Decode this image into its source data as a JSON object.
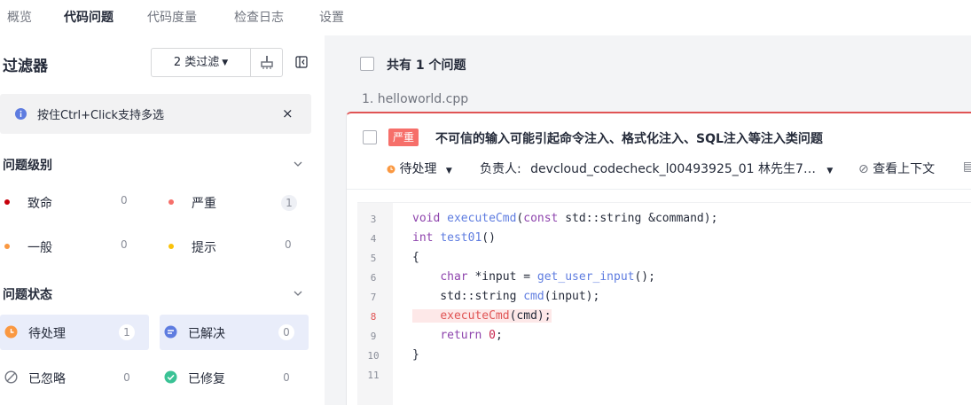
{
  "tabs": [
    "概览",
    "代码问题",
    "代码度量",
    "检查日志",
    "设置"
  ],
  "filter": {
    "title": "过滤器",
    "button_label": "2 类过滤",
    "clean_icon": "broom-icon",
    "collapse_icon": "panel-collapse-icon"
  },
  "tip": {
    "text": "按住Ctrl+Click支持多选",
    "close": "×"
  },
  "levels": {
    "title": "问题级别",
    "items": [
      {
        "name": "致命",
        "count": "0",
        "color": "#c7000b"
      },
      {
        "name": "严重",
        "count": "1",
        "color": "#f66f6a"
      },
      {
        "name": "一般",
        "count": "0",
        "color": "#fa9841"
      },
      {
        "name": "提示",
        "count": "0",
        "color": "#fac20a"
      }
    ]
  },
  "status": {
    "title": "问题状态",
    "items": [
      {
        "name": "待处理",
        "count": "1",
        "icon": "pending-icon",
        "color": "#fa9841",
        "selected": true
      },
      {
        "name": "已解决",
        "count": "0",
        "icon": "resolved-icon",
        "color": "#5e7ce0",
        "selected": true
      },
      {
        "name": "已忽略",
        "count": "0",
        "icon": "ignored-icon",
        "color": "#71757f",
        "selected": false
      },
      {
        "name": "已修复",
        "count": "0",
        "icon": "fixed-icon",
        "color": "#3ac295",
        "selected": false
      }
    ]
  },
  "issues": {
    "total": "共有 1 个问题",
    "file": "1. helloworld.cpp",
    "severity": "严重",
    "title": "不可信的输入可能引起命令注入、格式化注入、SQL注入等注入类问题",
    "status": "待处理",
    "assignee_label": "负责人:",
    "assignee": "devcloud_codecheck_l00493925_01 林先生7…",
    "context_link": "查看上下文"
  },
  "code": {
    "lines": [
      "3",
      "4",
      "5",
      "6",
      "7",
      "8",
      "9",
      "10",
      "11"
    ],
    "highlight_line": "8"
  },
  "colors": {
    "accent": "#5e7ce0",
    "critical_border": "#e05454"
  }
}
